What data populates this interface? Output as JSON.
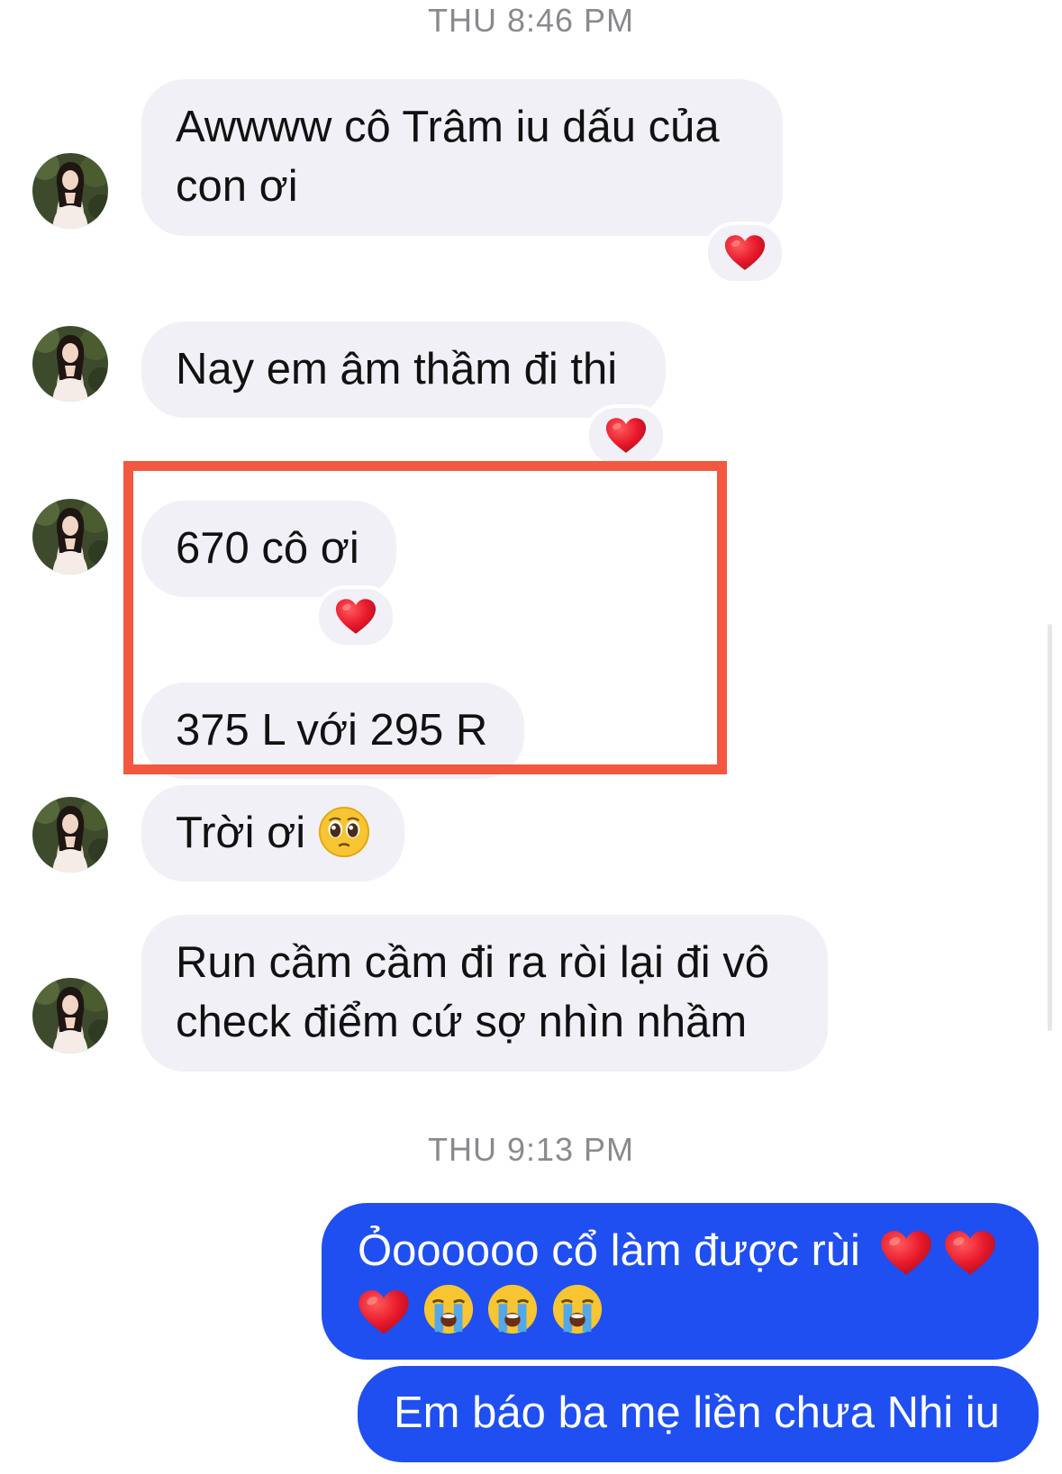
{
  "timestamps": [
    "THU 8:46 PM",
    "THU 9:13 PM"
  ],
  "messages_in": [
    {
      "lines": [
        "Awwww cô Trâm iu dấu của",
        "con ơi"
      ],
      "reaction": "heart-icon"
    },
    {
      "lines": [
        "Nay em âm thầm đi thi"
      ],
      "reaction": "heart-icon"
    },
    {
      "lines": [
        "670 cô ơi"
      ],
      "reaction": "heart-icon"
    },
    {
      "lines": [
        "375 L với 295 R"
      ]
    },
    {
      "text": "Trời ơi",
      "emoji": "pleading-face-icon"
    },
    {
      "lines": [
        "Run cầm cầm đi ra ròi lại đi vô",
        "check điểm cứ sợ nhìn nhầm"
      ]
    }
  ],
  "messages_out": [
    {
      "text": "Ỏoooooo cổ làm được rùi",
      "emojis": [
        "heart-icon",
        "heart-icon",
        "heart-icon",
        "crying-face-icon",
        "crying-face-icon",
        "crying-face-icon"
      ]
    },
    {
      "text": "Em báo ba mẹ liền chưa Nhi iu"
    }
  ],
  "colors": {
    "incoming_bubble": "#f0f0f6",
    "outgoing_bubble": "#1f4ff0",
    "highlight_border": "#f2573f",
    "heart": "#e8192c",
    "timestamp": "#8a8a8e"
  }
}
